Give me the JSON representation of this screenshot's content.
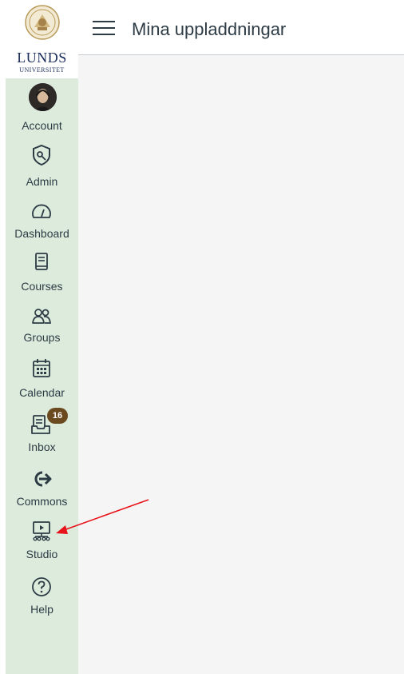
{
  "header": {
    "title": "Mina uppladdningar",
    "menu_icon": "hamburger-icon"
  },
  "logo": {
    "name": "LUNDS",
    "subtitle": "UNIVERSITET"
  },
  "nav": {
    "account": {
      "label": "Account",
      "icon": "avatar"
    },
    "admin": {
      "label": "Admin",
      "icon": "shield-icon"
    },
    "dashboard": {
      "label": "Dashboard",
      "icon": "speedometer-icon"
    },
    "courses": {
      "label": "Courses",
      "icon": "book-icon"
    },
    "groups": {
      "label": "Groups",
      "icon": "people-icon"
    },
    "calendar": {
      "label": "Calendar",
      "icon": "calendar-icon"
    },
    "inbox": {
      "label": "Inbox",
      "icon": "inbox-icon",
      "badge": "16"
    },
    "commons": {
      "label": "Commons",
      "icon": "commons-arrow-icon"
    },
    "studio": {
      "label": "Studio",
      "icon": "studio-icon"
    },
    "help": {
      "label": "Help",
      "icon": "help-icon"
    }
  },
  "colors": {
    "sidebar_bg": "#dcebdc",
    "text": "#2d3b45",
    "badge_bg": "#6b4a1f",
    "annotation_arrow": "#e8141b",
    "content_bg": "#f5f5f5"
  }
}
